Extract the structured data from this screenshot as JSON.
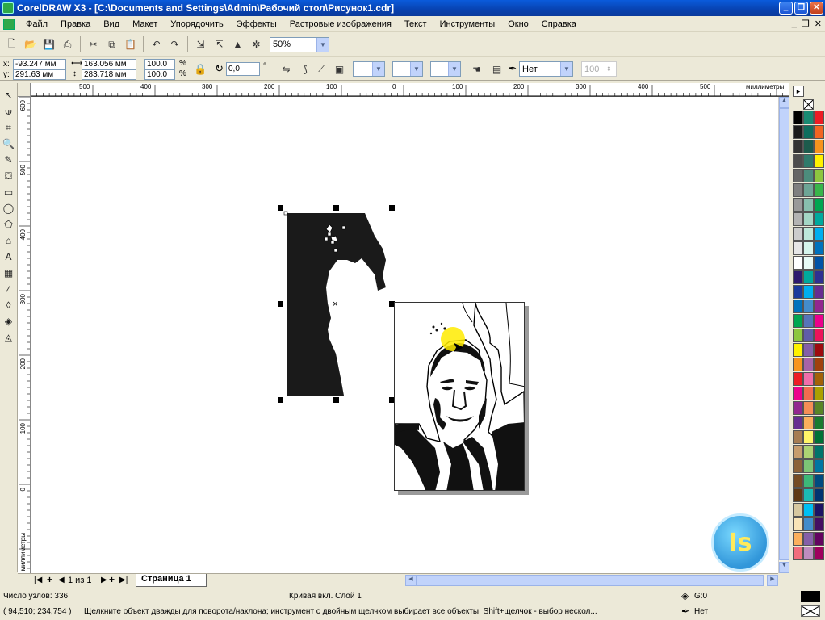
{
  "window": {
    "title": "CorelDRAW X3 - [C:\\Documents and Settings\\Admin\\Рабочий стол\\Рисунок1.cdr]",
    "min_label": "_",
    "max_label": "❐",
    "close_label": "✕"
  },
  "menu": {
    "items": [
      "Файл",
      "Правка",
      "Вид",
      "Макет",
      "Упорядочить",
      "Эффекты",
      "Растровые изображения",
      "Текст",
      "Инструменты",
      "Окно",
      "Справка"
    ],
    "doc_controls": [
      "_",
      "❐",
      "✕"
    ]
  },
  "toolbar": {
    "zoom_value": "50%"
  },
  "property_bar": {
    "x_label": "x:",
    "x_value": "-93.247 мм",
    "y_label": "y:",
    "y_value": "291.63 мм",
    "width_value": "163.056 мм",
    "height_value": "283.718 мм",
    "scale_x": "100.0",
    "scale_y": "100.0",
    "percent": "%",
    "rotation_value": "0,0",
    "degree": "°",
    "outline_value": "Нет",
    "opacity_value": "100"
  },
  "rulers": {
    "unit_label": "миллиметры",
    "h_ticks": [
      "500",
      "400",
      "300",
      "200",
      "100",
      "0",
      "100",
      "200",
      "300",
      "400",
      "500"
    ],
    "v_ticks": [
      "600",
      "500",
      "400",
      "300",
      "200",
      "100",
      "0"
    ]
  },
  "page_tabs": {
    "counter": "1 из 1",
    "page_name": "Страница 1"
  },
  "status": {
    "nodes": "Число узлов: 336",
    "object_info": "Кривая вкл. Слой 1",
    "coords": "( 94,510; 234,754 )",
    "hint": "Щелкните объект дважды для поворота/наклона; инструмент с двойным щелчком выбирает все объекты; Shift+щелчок - выбор нескол...",
    "fill_label": "G:0",
    "outline_label": "Нет"
  },
  "palette_colors": [
    "#000000",
    "#1b1b1b",
    "#333333",
    "#4d4d4d",
    "#666666",
    "#808080",
    "#999999",
    "#b3b3b3",
    "#cccccc",
    "#e6e6e6",
    "#ffffff",
    "#2e1a6e",
    "#1a3a9c",
    "#0072bc",
    "#00a651",
    "#8dc63f",
    "#fff200",
    "#f7941d",
    "#ed1c24",
    "#ec008c",
    "#92278f",
    "#662d91",
    "#a67c52",
    "#c69c6d",
    "#8c6239",
    "#754c24",
    "#603913",
    "#d7c8a0",
    "#f9e4b7",
    "#fbaf5d",
    "#f26d7d"
  ],
  "palette_colors_2": [
    "#1a8a72",
    "#0f6e5e",
    "#1d5b4c",
    "#2f7a6b",
    "#4c8c7c",
    "#6da596",
    "#88bfae",
    "#a3d6c5",
    "#bde8da",
    "#d6f5ec",
    "#e8fbf6",
    "#00a99d",
    "#00aeef",
    "#448ccb",
    "#5674b9",
    "#605ca8",
    "#855fa8",
    "#a763a8",
    "#f06eaa",
    "#f26c4f",
    "#f68e56",
    "#fbaf5d",
    "#fff568",
    "#acd373",
    "#7cc576",
    "#3cb878",
    "#1cbbb4",
    "#00bff3",
    "#438ccb",
    "#8560a8",
    "#bd8cbf"
  ],
  "palette_colors_3": [
    "#ed1c24",
    "#f26522",
    "#f7941d",
    "#fff200",
    "#8dc63f",
    "#39b54a",
    "#00a651",
    "#00a99d",
    "#00aeef",
    "#0072bc",
    "#0054a6",
    "#2e3192",
    "#662d91",
    "#92278f",
    "#ec008c",
    "#ed145b",
    "#9e0b0f",
    "#a0410d",
    "#a36209",
    "#aba000",
    "#598527",
    "#1a7b30",
    "#007236",
    "#00746b",
    "#0076a3",
    "#004b80",
    "#003471",
    "#1b1464",
    "#440e62",
    "#630460",
    "#9e005d"
  ],
  "logo": {
    "text": "Is"
  }
}
